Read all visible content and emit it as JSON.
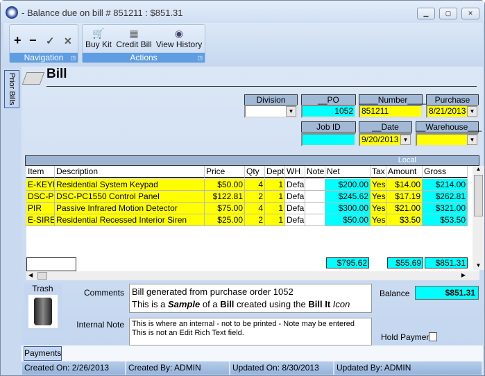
{
  "window": {
    "title": "- Balance due on bill # 851211 : $851.31",
    "controls": [
      "minimize",
      "maximize",
      "close"
    ]
  },
  "ribbon": {
    "navigation": {
      "caption": "Navigation",
      "buttons": [
        {
          "icon": "plus-icon",
          "symbol": "+"
        },
        {
          "icon": "minus-icon",
          "symbol": "−"
        },
        {
          "icon": "check-icon",
          "symbol": "✓"
        },
        {
          "icon": "close-icon",
          "symbol": "✕"
        }
      ]
    },
    "actions": {
      "caption": "Actions",
      "buttons": [
        {
          "label": "Buy Kit",
          "icon": "cart-icon"
        },
        {
          "label": "Credit Bill",
          "icon": "credit-icon"
        },
        {
          "label": "View History",
          "icon": "eye-icon"
        }
      ]
    }
  },
  "side_tab": "Prior Bills",
  "form": {
    "title": "Bill",
    "fields": {
      "division": {
        "label": "Division",
        "value": ""
      },
      "po_number": {
        "label": "__PO Number__",
        "value": "1052"
      },
      "number": {
        "label": "____Number_____",
        "value": "851211"
      },
      "purchase_date": {
        "label": "Purchase Date",
        "value": "8/21/2013"
      },
      "job_id": {
        "label": "Job ID",
        "value": ""
      },
      "date_due": {
        "label": "__Date Due__",
        "value": "9/20/2013"
      },
      "warehouse": {
        "label": "__Warehouse___",
        "value": ""
      }
    }
  },
  "grid": {
    "band_label": "Local",
    "columns": [
      "Item",
      "Description",
      "Price",
      "Qty",
      "Dept",
      "WH",
      "Note",
      "Net",
      "Tax",
      "Amount",
      "Gross"
    ],
    "rows": [
      [
        "E-KEYP",
        "Residential System Keypad",
        "$50.00",
        "4",
        "1",
        "Defau",
        "",
        "$200.00",
        "Yes",
        "$14.00",
        "$214.00"
      ],
      [
        "DSC-PC",
        "DSC-PC1550 Control Panel",
        "$122.81",
        "2",
        "1",
        "Defau",
        "",
        "$245.62",
        "Yes",
        "$17.19",
        "$262.81"
      ],
      [
        "PIR",
        "Passive Infrared Motion Detector",
        "$75.00",
        "4",
        "1",
        "Defau",
        "",
        "$300.00",
        "Yes",
        "$21.00",
        "$321.00"
      ],
      [
        "E-SIREN",
        "Residential Recessed Interior Siren",
        "$25.00",
        "2",
        "1",
        "Defau",
        "",
        "$50.00",
        "Yes",
        "$3.50",
        "$53.50"
      ]
    ],
    "totals": {
      "net": "$795.62",
      "amount": "$55.69",
      "gross": "$851.31"
    }
  },
  "bottom": {
    "trash_label": "Trash",
    "comments_label": "Comments",
    "comments_line1": "Bill generated from purchase order 1052",
    "comments_l2a": "This is a ",
    "comments_l2b": "Sample",
    "comments_l2c": " of a ",
    "comments_l2d": "Bill",
    "comments_l2e": " created using the ",
    "comments_l2f": "Bill It",
    "comments_l2g": " Icon",
    "internal_note_label": "Internal Note",
    "internal_note_line1": "This is where an internal - not to be printed - Note may be entered",
    "internal_note_line2": "This is not an Edit Rich Text field.",
    "balance_label": "Balance",
    "balance_value": "$851.31",
    "hold_payment_label": "Hold Payment",
    "hold_payment_checked": false,
    "payments_tab": "Payments"
  },
  "status": {
    "created_on": "Created On: 2/26/2013",
    "created_by": "Created By: ADMIN",
    "updated_on": "Updated On: 8/30/2013",
    "updated_by": "Updated By: ADMIN"
  }
}
